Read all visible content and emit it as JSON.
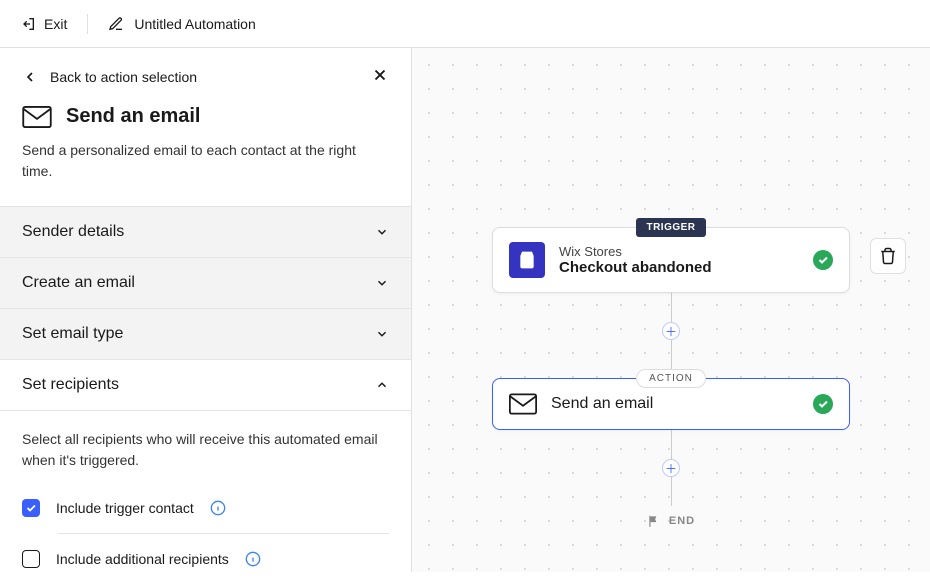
{
  "topbar": {
    "exit_label": "Exit",
    "title": "Untitled Automation"
  },
  "sidebar": {
    "back_label": "Back to action selection",
    "title": "Send an email",
    "description": "Send a personalized email to each contact at the right time.",
    "sections": {
      "sender": {
        "label": "Sender details"
      },
      "create": {
        "label": "Create an email"
      },
      "type": {
        "label": "Set email type"
      },
      "recipients": {
        "label": "Set recipients",
        "description": "Select all recipients who will receive this automated email when it's triggered.",
        "include_trigger_label": "Include trigger contact",
        "include_trigger_checked": true,
        "include_additional_label": "Include additional recipients",
        "include_additional_checked": false
      }
    }
  },
  "canvas": {
    "trigger_badge": "TRIGGER",
    "action_badge": "ACTION",
    "end_label": "END",
    "trigger": {
      "app": "Wix Stores",
      "title": "Checkout abandoned"
    },
    "action": {
      "title": "Send an email"
    }
  }
}
